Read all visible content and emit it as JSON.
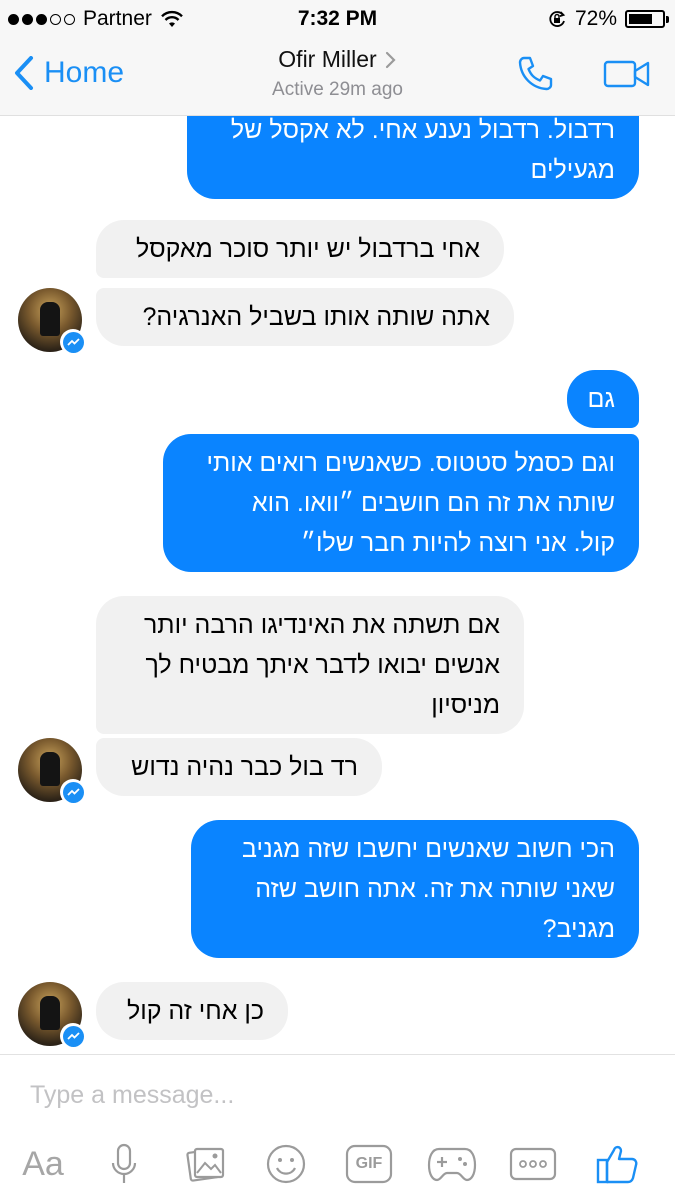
{
  "status_bar": {
    "carrier": "Partner",
    "time": "7:32 PM",
    "battery": "72%",
    "battery_level": 0.72,
    "signal_bars_filled": 3,
    "signal_bars_total": 5
  },
  "header": {
    "back_label": "Home",
    "contact_name": "Ofir Miller",
    "status": "Active 29m ago",
    "accent_color": "#1a8ff5"
  },
  "messages": [
    {
      "side": "out",
      "lines": [
        "רדבול. רדבול נענע אחי. לא אקסל של",
        "מגעילים"
      ]
    },
    {
      "side": "in",
      "lines": [
        "אחי ברדבול יש יותר סוכר מאקסל"
      ]
    },
    {
      "side": "in",
      "lines": [
        "אתה שותה אותו בשביל האנרגיה?"
      ]
    },
    {
      "side": "out",
      "lines": [
        "גם"
      ]
    },
    {
      "side": "out",
      "lines": [
        "וגם כסמל סטטוס. כשאנשים רואים אותי",
        "שותה את זה הם חושבים ״וואו. הוא",
        "קול. אני רוצה להיות חבר שלו״"
      ]
    },
    {
      "side": "in",
      "lines": [
        "אם תשתה את האינדיגו הרבה יותר",
        "אנשים יבואו לדבר איתך מבטיח לך",
        "מניסיון"
      ]
    },
    {
      "side": "in",
      "lines": [
        "רד בול כבר נהיה נדוש"
      ]
    },
    {
      "side": "out",
      "lines": [
        "הכי חשוב שאנשים יחשבו שזה מגניב",
        "שאני שותה את זה. אתה חושב שזה",
        "מגניב?"
      ]
    },
    {
      "side": "in",
      "lines": [
        "כן אחי זה קול"
      ]
    }
  ],
  "composer": {
    "placeholder": "Type a message...",
    "tools": [
      {
        "name": "text-format",
        "label": "Aa"
      },
      {
        "name": "microphone-icon"
      },
      {
        "name": "photo-gallery-icon"
      },
      {
        "name": "emoji-icon"
      },
      {
        "name": "gif-icon",
        "label": "GIF"
      },
      {
        "name": "game-controller-icon"
      },
      {
        "name": "more-icon"
      },
      {
        "name": "thumbs-up-icon"
      }
    ]
  },
  "colors": {
    "outgoing_bubble": "#0a84ff",
    "incoming_bubble": "#f1f1f1"
  }
}
